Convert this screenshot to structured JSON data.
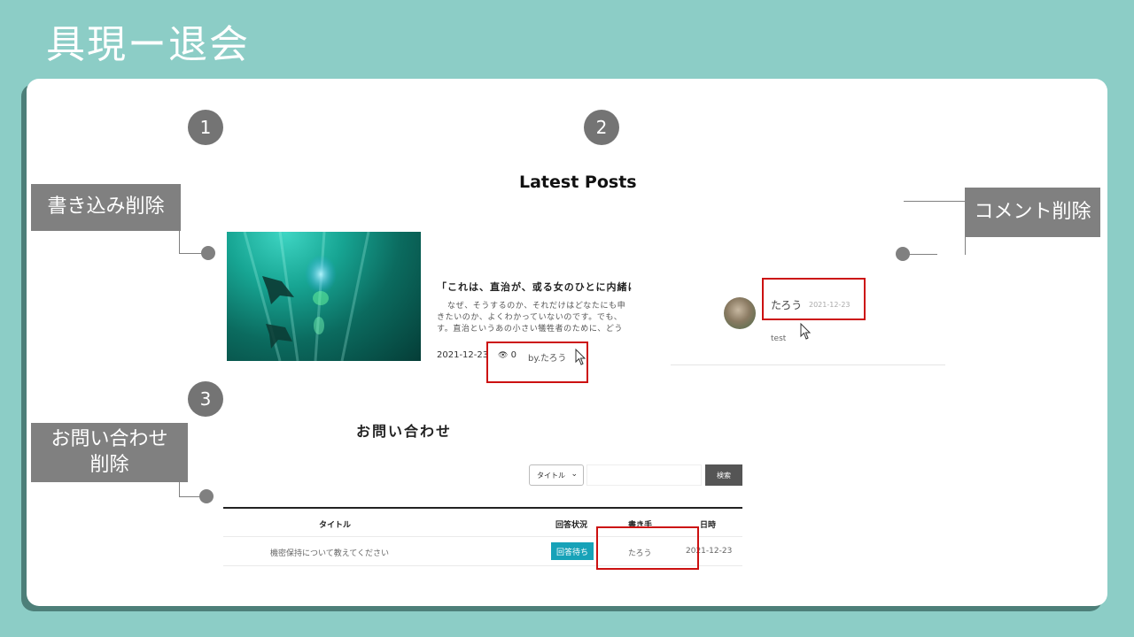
{
  "slide": {
    "title": "具現ー退会"
  },
  "steps": [
    "1",
    "2",
    "3"
  ],
  "callouts": {
    "post_delete": "書き込み削除",
    "comment_delete": "コメント削除",
    "inquiry_delete_line1": "お問い合わせ",
    "inquiry_delete_line2": "削除"
  },
  "latest_posts": {
    "title": "Latest Posts",
    "post": {
      "heading": "「これは、直治が、或る女のひとに内緒に",
      "body_lines": [
        "なぜ、そうするのか、それだけはどなたにも申",
        "きたいのか、よくわかっていないのです。でも、",
        "す。直治というあの小さい犠牲者のために、どう"
      ],
      "date": "2021-12-23",
      "views_icon": "eye-icon",
      "views": "0",
      "author": "by.たろう"
    }
  },
  "comment": {
    "name": "たろう",
    "date": "2021-12-23",
    "text": "test"
  },
  "inquiry": {
    "title": "お問い合わせ",
    "search": {
      "select_value": "タイトル",
      "input_value": "",
      "button_label": "検索"
    },
    "columns": [
      "タイトル",
      "回答状況",
      "書き手",
      "日時"
    ],
    "rows": [
      {
        "title": "機密保持について教えてください",
        "status": "回答待ち",
        "writer": "たろう",
        "date": "2021-12-23"
      }
    ]
  },
  "colors": {
    "background": "#8ccdc6",
    "callout": "#808080",
    "highlight": "#cc1111",
    "badge": "#17a2b8"
  }
}
